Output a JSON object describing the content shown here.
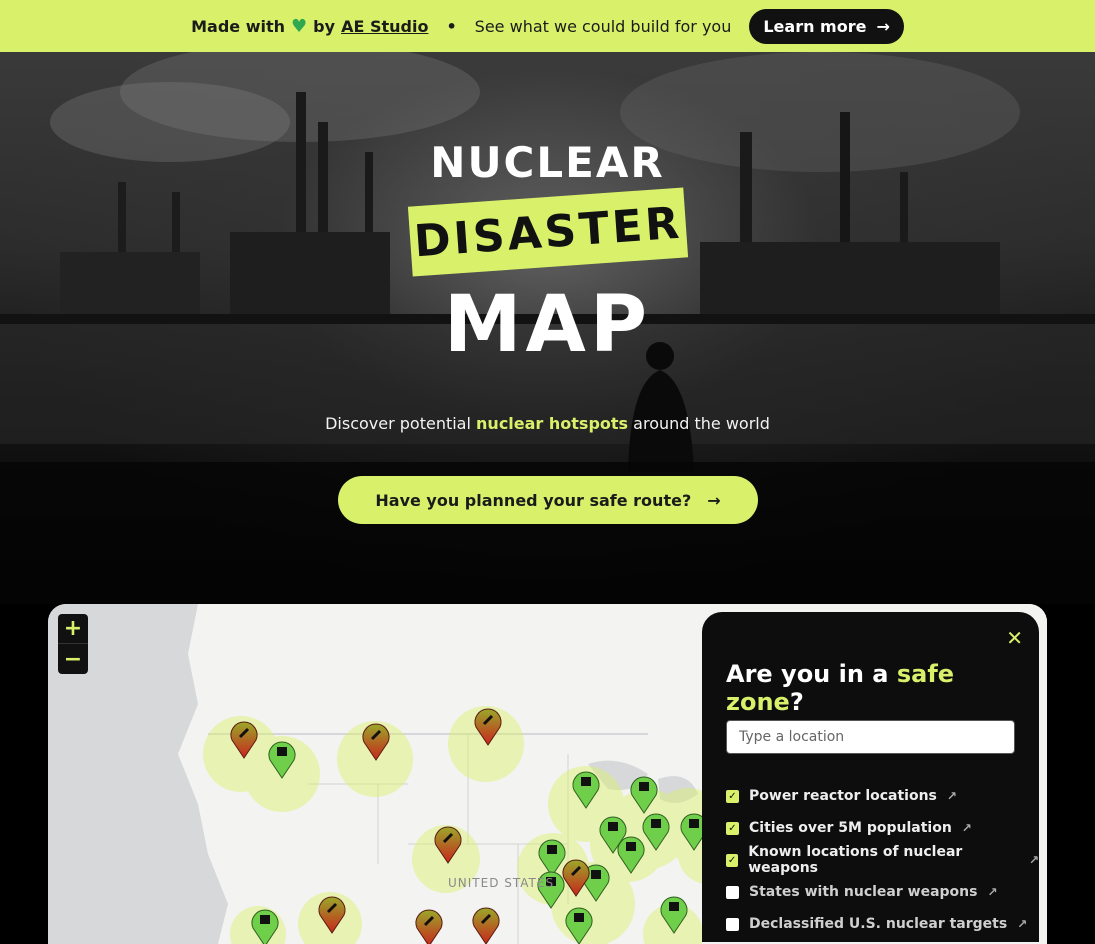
{
  "banner": {
    "made_with": "Made with",
    "heart_icon": "green-heart-icon",
    "by": "by",
    "studio": "AE Studio",
    "separator": "•",
    "tagline": "See what we could build for you",
    "learn_more": "Learn more",
    "colors": {
      "background": "#d9f16a",
      "button": "#111111"
    }
  },
  "hero": {
    "title_line1": "NUCLEAR",
    "title_line2": "DISASTER",
    "title_line3": "MAP",
    "subtitle_prefix": "Discover potential",
    "subtitle_highlight": "nuclear hotspots",
    "subtitle_suffix": "around the world",
    "cta_label": "Have you planned your safe route?"
  },
  "map": {
    "zoom_in": "+",
    "zoom_out": "−",
    "country_label": "UNITED STATES"
  },
  "panel": {
    "close": "✕",
    "heading_prefix": "Are you in a",
    "heading_highlight": "safe zone",
    "heading_suffix": "?",
    "location_placeholder": "Type a location",
    "options": [
      {
        "label": "Power reactor locations",
        "checked": true
      },
      {
        "label": "Cities over 5M population",
        "checked": true
      },
      {
        "label": "Known locations of nuclear weapons",
        "checked": true
      },
      {
        "label": "States with nuclear weapons",
        "checked": false
      },
      {
        "label": "Declassified U.S. nuclear targets",
        "checked": false
      }
    ]
  },
  "colors": {
    "accent": "#d9f16a",
    "reactor_marker": "#6fcf4a",
    "weapon_marker": "#c8261c"
  }
}
